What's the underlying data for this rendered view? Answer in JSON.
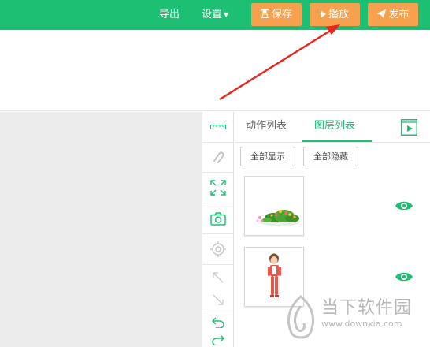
{
  "toolbar": {
    "export_label": "导出",
    "settings_label": "设置",
    "save_label": "保存",
    "play_label": "播放",
    "publish_label": "发布"
  },
  "panel": {
    "tabs": [
      {
        "label": "动作列表",
        "active": false
      },
      {
        "label": "图层列表",
        "active": true
      }
    ],
    "show_all_label": "全部显示",
    "hide_all_label": "全部隐藏",
    "layers": [
      {
        "name": "flower-bush",
        "visible": true
      },
      {
        "name": "girl-character",
        "visible": true
      }
    ]
  },
  "tools": [
    "ruler-icon",
    "magnet-icon",
    "fullscreen-icon",
    "camera-icon",
    "target-icon",
    "move-up-left-icon",
    "move-down-right-icon",
    "undo-icon",
    "redo-icon"
  ],
  "watermark": {
    "title": "当下软件园",
    "url": "www.downxia.com"
  },
  "colors": {
    "brand_green": "#1dbf73",
    "accent_orange": "#f7a14e",
    "annotation_red": "#e8251f"
  }
}
